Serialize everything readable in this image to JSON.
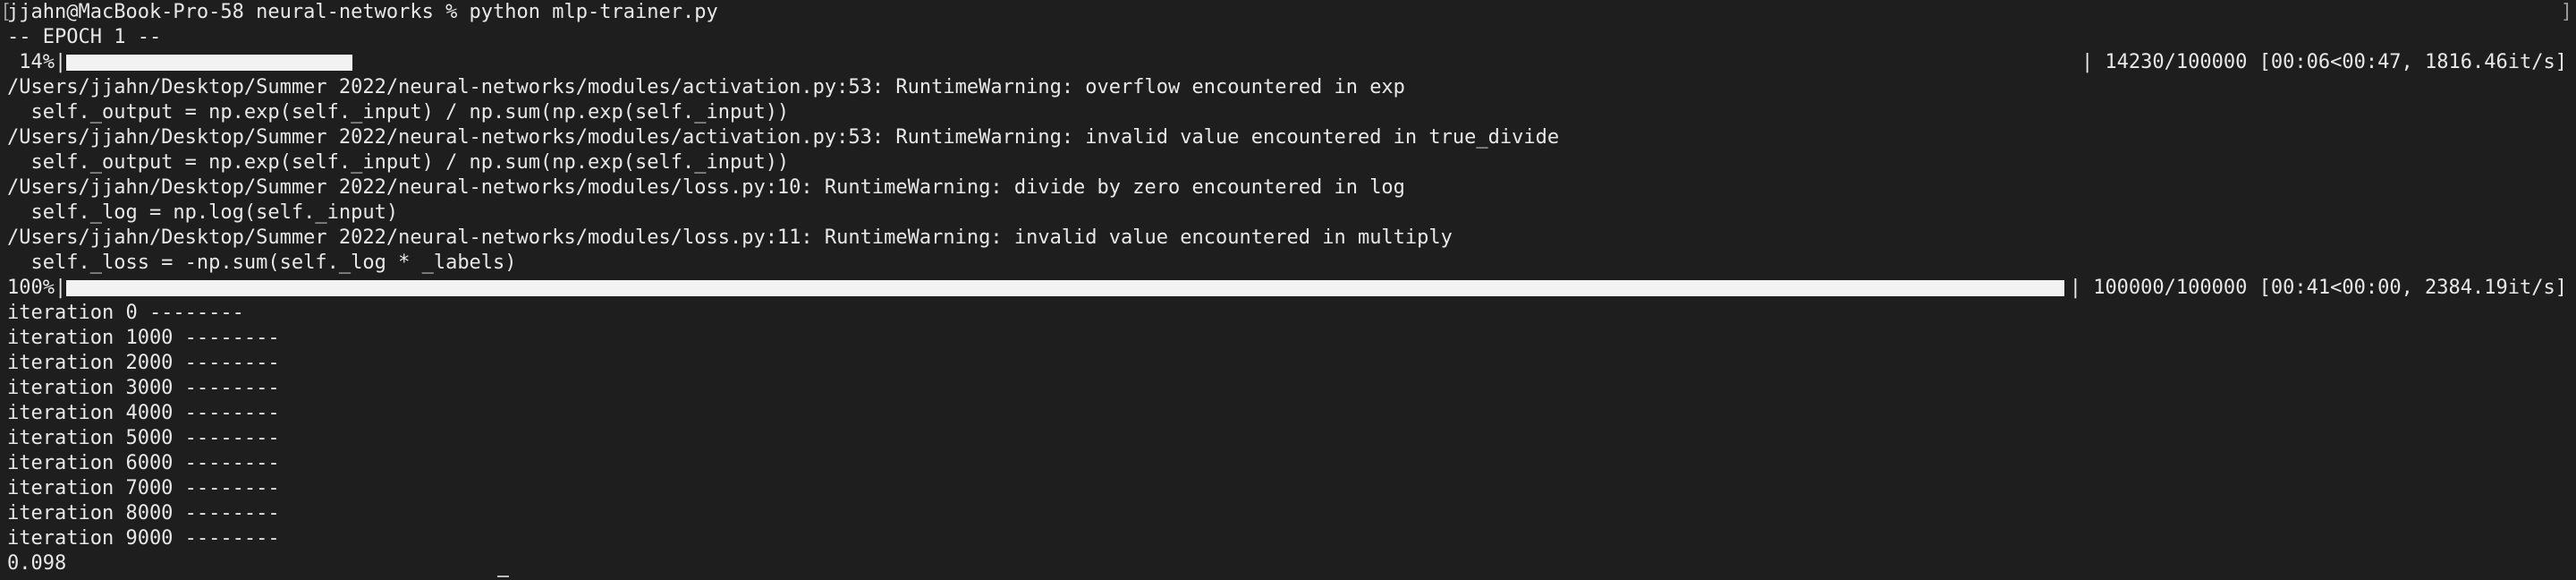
{
  "terminal": {
    "brackets": {
      "left": "[",
      "right": "]"
    },
    "prompt_line": "jjahn@MacBook-Pro-58 neural-networks % python mlp-trainer.py",
    "epoch_header": "-- EPOCH 1 --",
    "progress_bars": [
      {
        "percent_label": " 14%|",
        "stats": "| 14230/100000 [00:06<00:47, 1816.46it/s]",
        "fraction": 0.1423
      },
      {
        "percent_label": "100%|",
        "stats": "| 100000/100000 [00:41<00:00, 2384.19it/s]",
        "fraction": 1.0
      }
    ],
    "warnings": [
      "/Users/jjahn/Desktop/Summer 2022/neural-networks/modules/activation.py:53: RuntimeWarning: overflow encountered in exp",
      "  self._output = np.exp(self._input) / np.sum(np.exp(self._input))",
      "/Users/jjahn/Desktop/Summer 2022/neural-networks/modules/activation.py:53: RuntimeWarning: invalid value encountered in true_divide",
      "  self._output = np.exp(self._input) / np.sum(np.exp(self._input))",
      "/Users/jjahn/Desktop/Summer 2022/neural-networks/modules/loss.py:10: RuntimeWarning: divide by zero encountered in log",
      "  self._log = np.log(self._input)",
      "/Users/jjahn/Desktop/Summer 2022/neural-networks/modules/loss.py:11: RuntimeWarning: invalid value encountered in multiply",
      "  self._loss = -np.sum(self._log * _labels)"
    ],
    "iterations": [
      "iteration 0 --------",
      "iteration 1000 --------",
      "iteration 2000 --------",
      "iteration 3000 --------",
      "iteration 4000 --------",
      "iteration 5000 --------",
      "iteration 6000 --------",
      "iteration 7000 --------",
      "iteration 8000 --------",
      "iteration 9000 --------"
    ],
    "result": "0.098"
  }
}
